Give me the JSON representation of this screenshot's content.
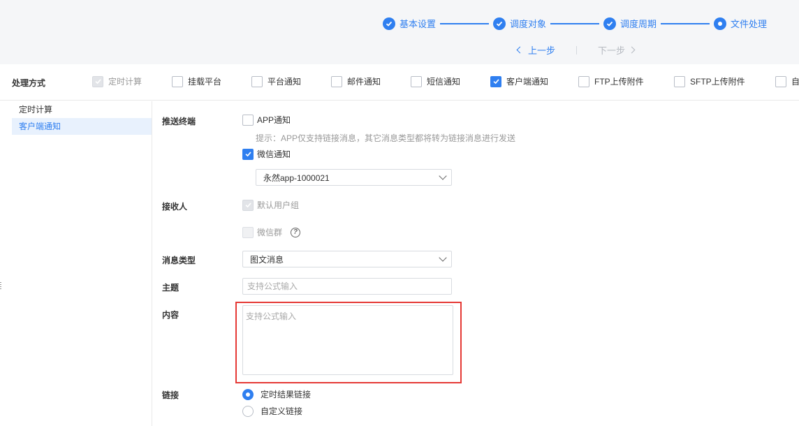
{
  "colors": {
    "accent": "#2f7ff0",
    "highlight_border": "#e53935",
    "disabled_text": "#999999"
  },
  "steps": [
    {
      "label": "基本设置",
      "state": "done"
    },
    {
      "label": "调度对象",
      "state": "done"
    },
    {
      "label": "调度周期",
      "state": "done"
    },
    {
      "label": "文件处理",
      "state": "current"
    }
  ],
  "pager": {
    "prev": "上一步",
    "next": "下一步"
  },
  "method": {
    "title": "处理方式",
    "options": [
      {
        "label": "定时计算",
        "checked": true,
        "disabled": true
      },
      {
        "label": "挂载平台",
        "checked": false
      },
      {
        "label": "平台通知",
        "checked": false
      },
      {
        "label": "邮件通知",
        "checked": false
      },
      {
        "label": "短信通知",
        "checked": false
      },
      {
        "label": "客户端通知",
        "checked": true
      },
      {
        "label": "FTP上传附件",
        "checked": false
      },
      {
        "label": "SFTP上传附件",
        "checked": false
      },
      {
        "label": "自",
        "checked": false
      }
    ]
  },
  "left_list": [
    {
      "label": "定时计算",
      "active": false
    },
    {
      "label": "客户端通知",
      "active": true
    }
  ],
  "form": {
    "push_terminal": {
      "label": "推送终端",
      "app": {
        "label": "APP通知",
        "checked": false
      },
      "hint": "提示：APP仅支持链接消息，其它消息类型都将转为链接消息进行发送",
      "wechat": {
        "label": "微信通知",
        "checked": true
      },
      "app_select": "永然app-1000021"
    },
    "receiver": {
      "label": "接收人",
      "default_group": {
        "label": "默认用户组",
        "checked": true,
        "disabled": true
      },
      "wechat_group": {
        "label": "微信群",
        "checked": false,
        "disabled": true
      },
      "help": "?"
    },
    "msg_type": {
      "label": "消息类型",
      "value": "图文消息"
    },
    "subject": {
      "label": "主题",
      "placeholder": "支持公式输入"
    },
    "content": {
      "label": "内容",
      "placeholder": "支持公式输入"
    },
    "link": {
      "label": "链接",
      "options": [
        {
          "label": "定时结果链接",
          "checked": true
        },
        {
          "label": "自定义链接",
          "checked": false
        }
      ]
    }
  }
}
